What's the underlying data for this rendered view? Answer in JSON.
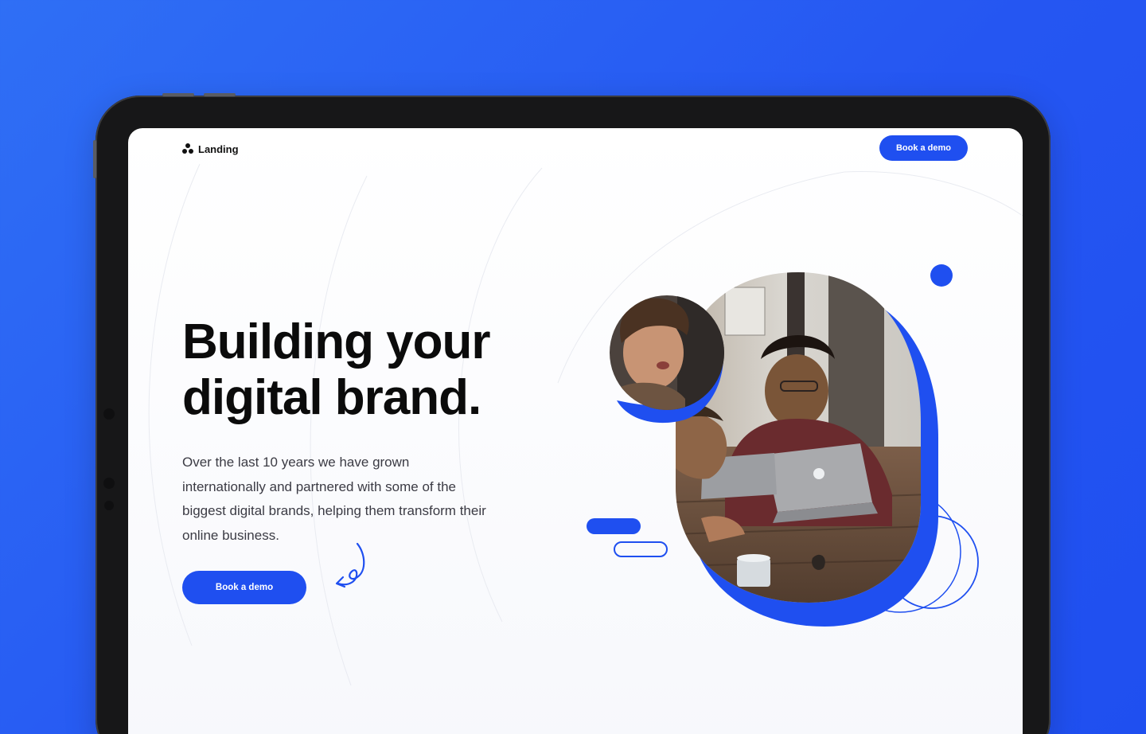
{
  "navbar": {
    "brand": "Landing",
    "cta_label": "Book a demo"
  },
  "hero": {
    "title_line1": "Building your",
    "title_line2": "digital brand.",
    "description": "Over the last 10 years we have grown internationally and partnered with some of the biggest digital brands, helping them transform their online business.",
    "cta_label": "Book a demo"
  },
  "colors": {
    "page_background": "#2556f2",
    "accent": "#1f4ff0",
    "device_frame": "#171718",
    "heading": "#0b0b0b",
    "body_text": "#3b3b44"
  },
  "icons": {
    "brand_logo": "three-dots-logo-icon",
    "arrow": "curly-arrow-icon"
  }
}
